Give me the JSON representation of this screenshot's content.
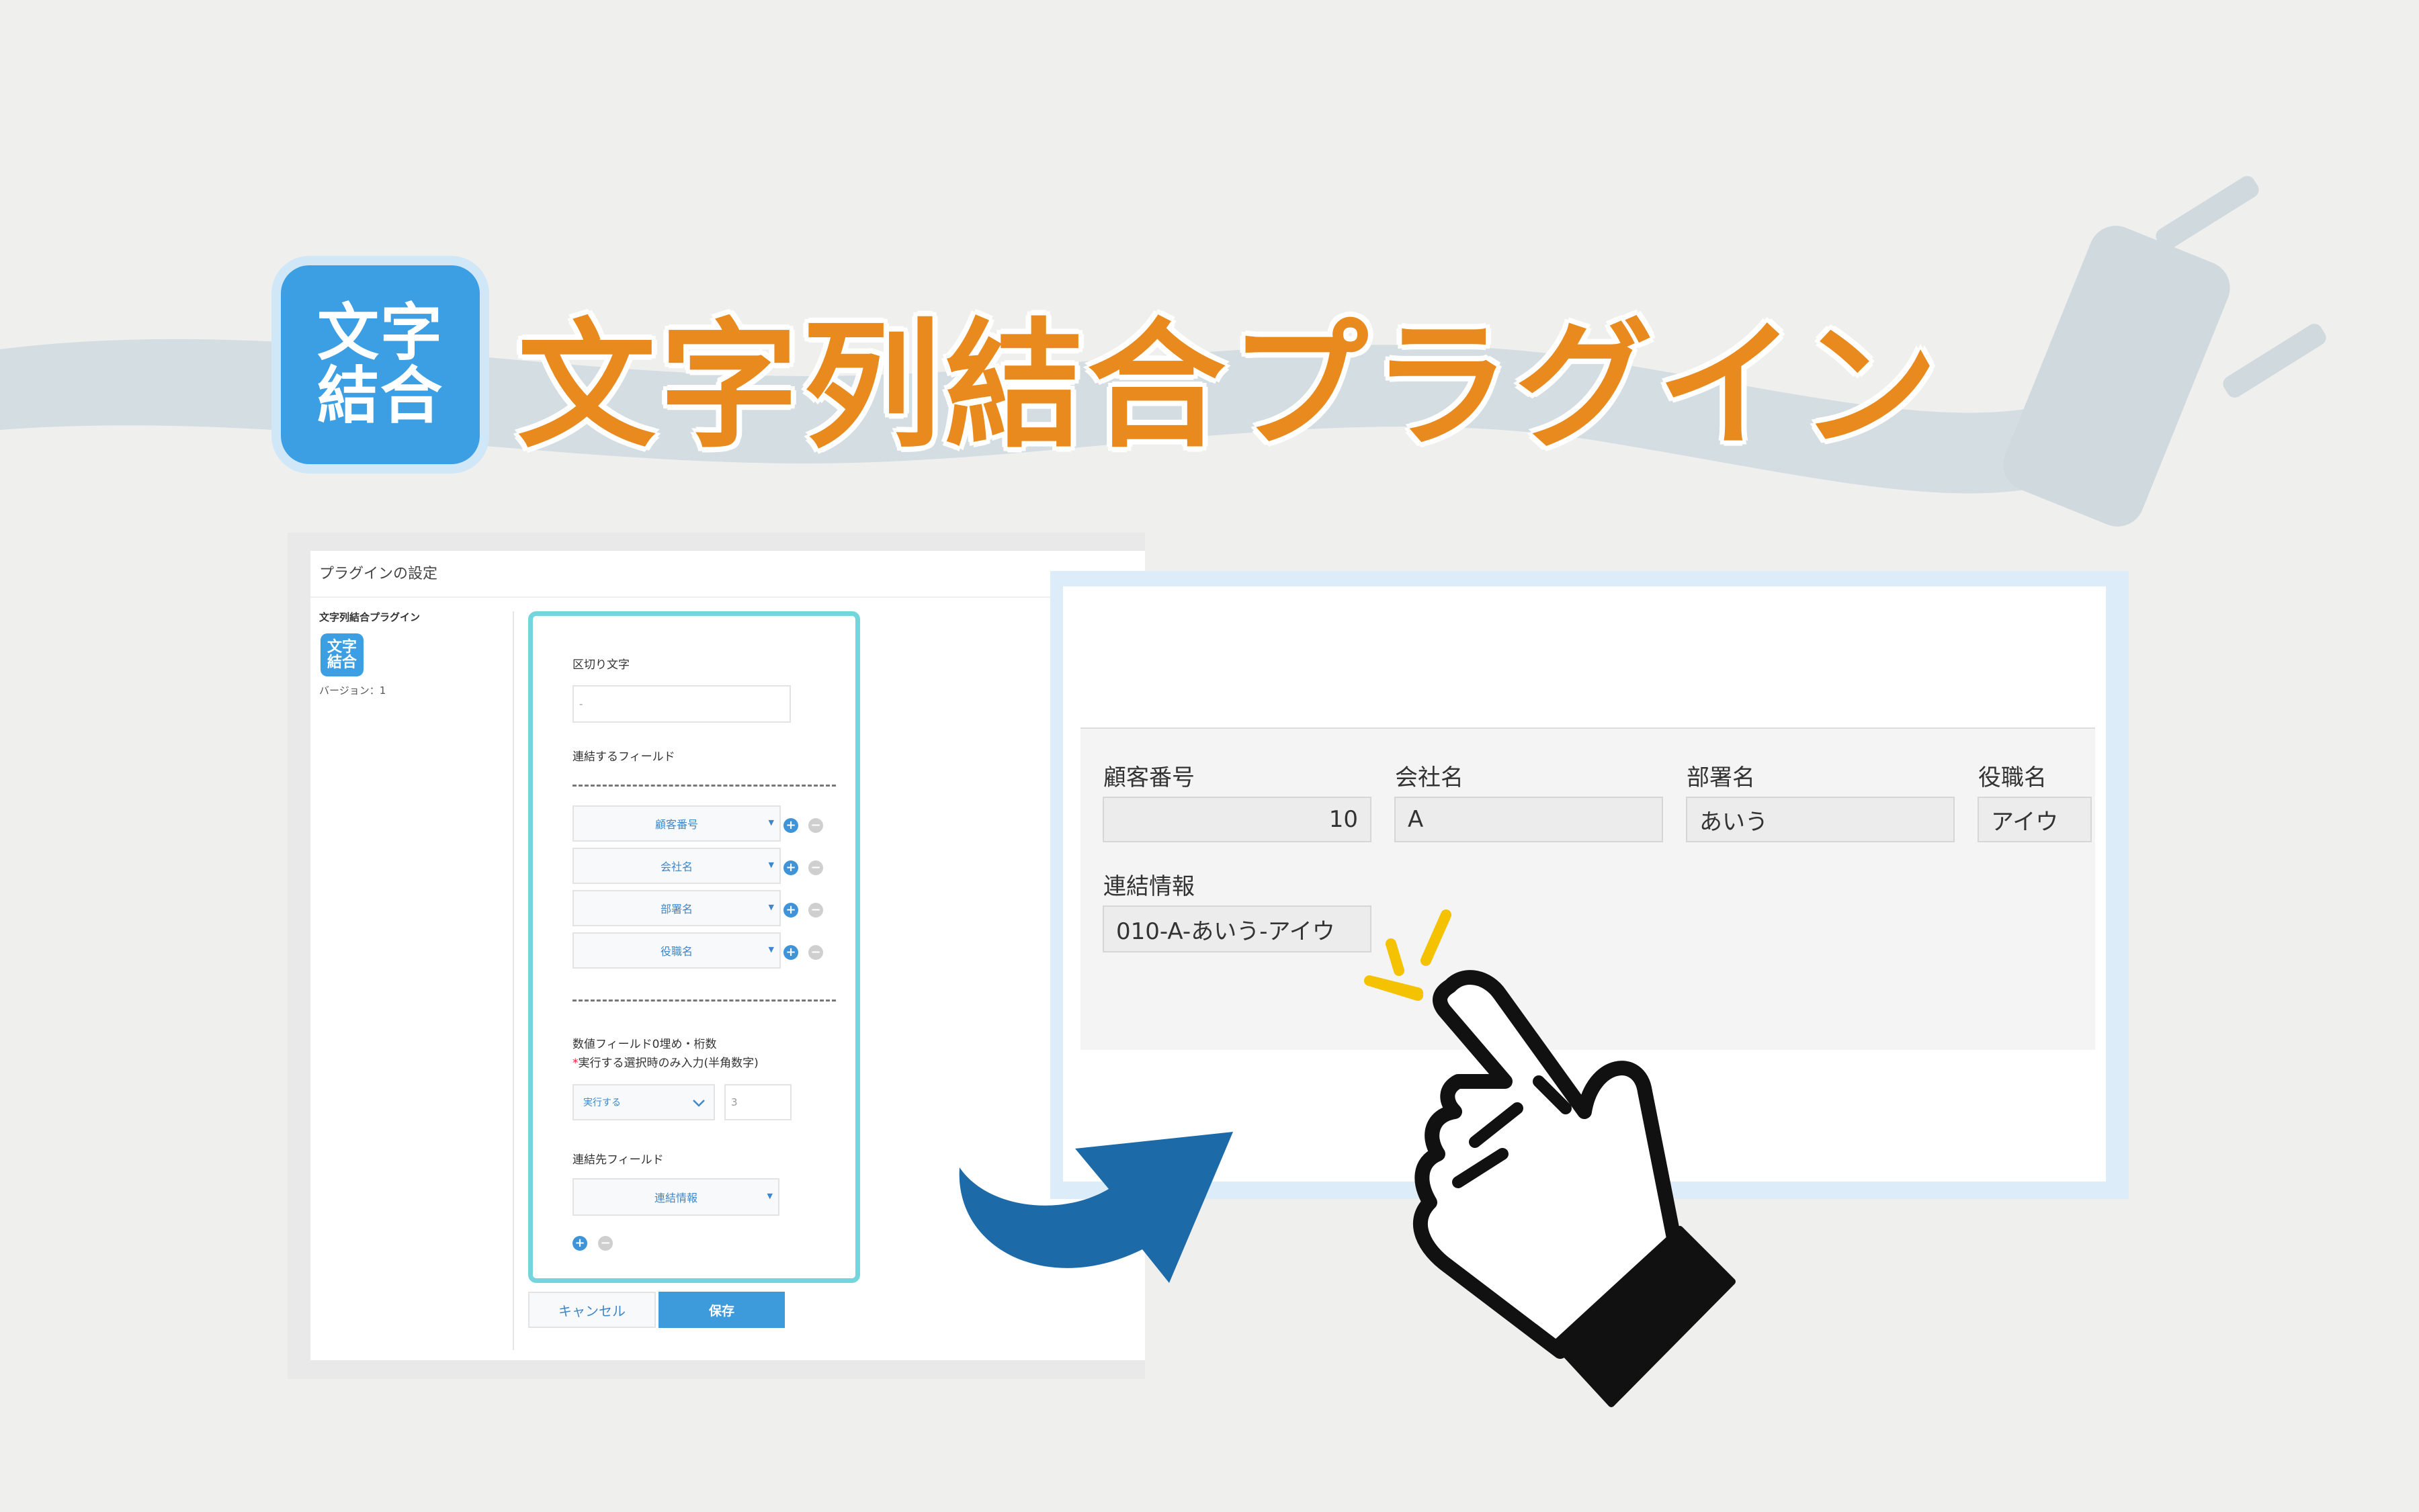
{
  "colors": {
    "title_orange": "#e88a1e",
    "icon_blue": "#3d9fe3",
    "config_border": "#74d5dc",
    "arrow_blue": "#1d6aa8",
    "accent_yellow": "#f4c200"
  },
  "banner": {
    "icon_line1": "文字",
    "icon_line2": "結合",
    "title": "文字列結合プラグイン"
  },
  "settings": {
    "header": "プラグインの設定",
    "plugin_name": "文字列結合プラグイン",
    "icon_line1": "文字",
    "icon_line2": "結合",
    "version": "バージョン：1",
    "delimiter_label": "区切り文字",
    "delimiter_value": "-",
    "join_fields_label": "連結するフィールド",
    "join_fields": [
      "顧客番号",
      "会社名",
      "部署名",
      "役職名"
    ],
    "zero_pad_label": "数値フィールド0埋め・桁数",
    "zero_pad_note": "実行する選択時のみ入力(半角数字)",
    "zero_pad_note_mark": "*",
    "zero_pad_select": "実行する",
    "zero_pad_digits": "3",
    "target_field_label": "連結先フィールド",
    "target_field": "連結情報",
    "cancel_label": "キャンセル",
    "save_label": "保存",
    "plus_symbol": "+",
    "minus_symbol": "−"
  },
  "record": {
    "fields": [
      {
        "label": "顧客番号",
        "value": "10"
      },
      {
        "label": "会社名",
        "value": "A"
      },
      {
        "label": "部署名",
        "value": "あいう"
      },
      {
        "label": "役職名",
        "value": "アイウ"
      }
    ],
    "result_label": "連結情報",
    "result_value": "010-A-あいう-アイウ"
  },
  "icons": [
    "plug-icon",
    "curved-arrow-icon",
    "pointing-hand-icon",
    "click-burst-icon",
    "caret-down-icon"
  ]
}
